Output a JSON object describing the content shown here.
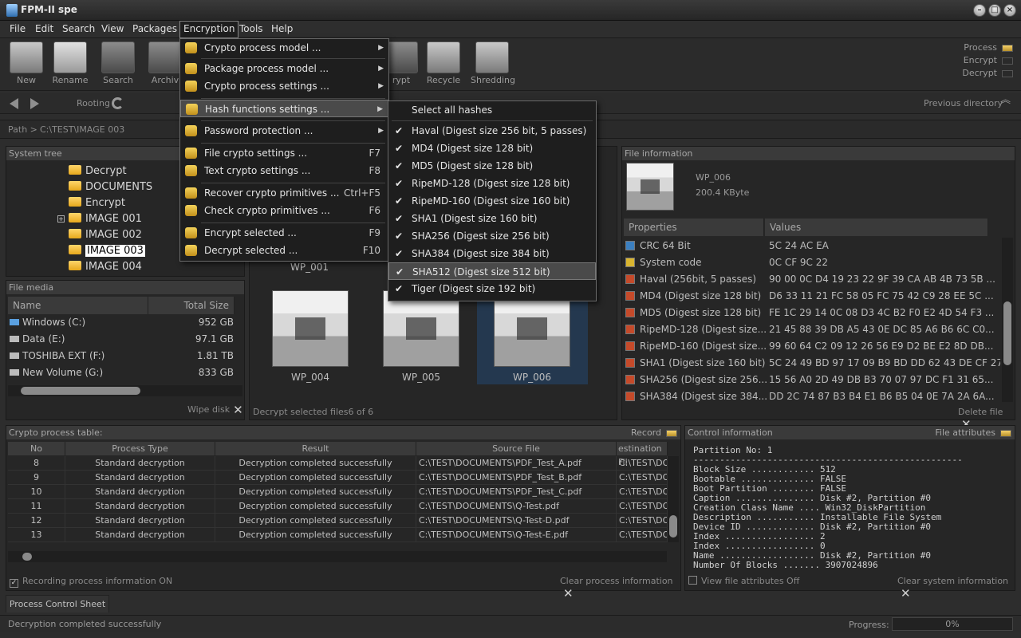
{
  "app": {
    "title": "FPM-II spe"
  },
  "menubar": {
    "items": [
      "File",
      "Edit",
      "Search",
      "View",
      "Packages",
      "Encryption",
      "Tools",
      "Help"
    ]
  },
  "toolbar": {
    "buttons": [
      "New",
      "Rename",
      "Search",
      "Archiv",
      "rypt",
      "Recycle",
      "Shredding"
    ],
    "indicators": [
      "Process",
      "Encrypt",
      "Decrypt"
    ]
  },
  "nav": {
    "rooting": "Rooting",
    "previous": "Previous directory"
  },
  "path": {
    "label": "Path >",
    "value": "C:\\TEST\\IMAGE 003"
  },
  "system_tree": {
    "title": "System tree",
    "items": [
      "Decrypt",
      "DOCUMENTS",
      "Encrypt",
      "IMAGE 001",
      "IMAGE 002",
      "IMAGE 003",
      "IMAGE 004"
    ],
    "expander": "+"
  },
  "file_media": {
    "title": "File media",
    "col_name": "Name",
    "col_size": "Total Size",
    "drives": [
      {
        "name": "Windows  (C:)",
        "size": "952 GB"
      },
      {
        "name": "Data (E:)",
        "size": "97.1 GB"
      },
      {
        "name": "TOSHIBA EXT (F:)",
        "size": "1.81 TB"
      },
      {
        "name": "New Volume (G:)",
        "size": "833 GB"
      }
    ],
    "wipe": "Wipe disk"
  },
  "thumbs": {
    "items": [
      "WP_001",
      "WP_004",
      "WP_005",
      "WP_006"
    ],
    "footer": "Decrypt selected files",
    "count": "6 of 6"
  },
  "file_info": {
    "title": "File information",
    "name": "WP_006",
    "size": "200.4 KByte",
    "col_props": "Properties",
    "col_values": "Values",
    "rows": [
      {
        "p": "CRC 64 Bit",
        "v": "5C 24 AC EA",
        "c": "blue"
      },
      {
        "p": "System code",
        "v": "0C CF 9C 22",
        "c": "yellow"
      },
      {
        "p": "Haval (256bit, 5 passes)",
        "v": "90 00 0C D4 19 23 22 9F 39 CA AB 4B 73 5B ...",
        "c": "red"
      },
      {
        "p": "MD4 (Digest size 128 bit)",
        "v": "D6 33 11 21 FC 58 05 FC 75 42 C9 28 EE 5C ...",
        "c": "red"
      },
      {
        "p": "MD5 (Digest size 128 bit)",
        "v": "FE 1C 29 14 0C 08 D3 4C B2 F0 E2 4D 54 F3 ...",
        "c": "red"
      },
      {
        "p": "RipeMD-128 (Digest size...",
        "v": "21 45 88 39 DB A5 43 0E DC 85 A6 B6 6C C0...",
        "c": "red"
      },
      {
        "p": "RipeMD-160 (Digest size...",
        "v": "99 60 64 C2 09 12 26 56 E9 D2 BE E2 8D DB...",
        "c": "red"
      },
      {
        "p": "SHA1 (Digest size 160 bit)",
        "v": "5C 24 49 BD 97 17 09 B9 BD DD 62 43 DE CF 27...",
        "c": "red"
      },
      {
        "p": "SHA256 (Digest size 256...",
        "v": "15 56 A0 2D 49 DB B3 70 07 97 DC F1 31 65...",
        "c": "red"
      },
      {
        "p": "SHA384 (Digest size 384...",
        "v": "DD 2C 74 87 B3 B4 E1 B6 B5 04 0E 7A 2A 6A...",
        "c": "red"
      }
    ],
    "delete": "Delete file"
  },
  "crypto_table": {
    "title": "Crypto process table:",
    "record": "Record",
    "headers": [
      "No",
      "Process Type",
      "Result",
      "Source File",
      "estination Fil"
    ],
    "rows": [
      {
        "no": "8",
        "type": "Standard decryption",
        "result": "Decryption completed successfully",
        "src": "C:\\TEST\\DOCUMENTS\\PDF_Test_A.pdf",
        "dst": "C:\\TEST\\DO("
      },
      {
        "no": "9",
        "type": "Standard decryption",
        "result": "Decryption completed successfully",
        "src": "C:\\TEST\\DOCUMENTS\\PDF_Test_B.pdf",
        "dst": "C:\\TEST\\DO("
      },
      {
        "no": "10",
        "type": "Standard decryption",
        "result": "Decryption completed successfully",
        "src": "C:\\TEST\\DOCUMENTS\\PDF_Test_C.pdf",
        "dst": "C:\\TEST\\DO("
      },
      {
        "no": "11",
        "type": "Standard decryption",
        "result": "Decryption completed successfully",
        "src": "C:\\TEST\\DOCUMENTS\\Q-Test.pdf",
        "dst": "C:\\TEST\\DO("
      },
      {
        "no": "12",
        "type": "Standard decryption",
        "result": "Decryption completed successfully",
        "src": "C:\\TEST\\DOCUMENTS\\Q-Test-D.pdf",
        "dst": "C:\\TEST\\DO("
      },
      {
        "no": "13",
        "type": "Standard decryption",
        "result": "Decryption completed successfully",
        "src": "C:\\TEST\\DOCUMENTS\\Q-Test-E.pdf",
        "dst": "C:\\TEST\\DO("
      }
    ],
    "recording": "Recording process information ON",
    "clear": "Clear process information"
  },
  "control": {
    "title": "Control information",
    "attrs": "File attributes",
    "text": "Partition No: 1\n---------------------------------------------------\nBlock Size ............ 512\nBootable .............. FALSE\nBoot Partition ........ FALSE\nCaption ............... Disk #2, Partition #0\nCreation Class Name .... Win32_DiskPartition\nDescription ........... Installable File System\nDevice ID ............. Disk #2, Partition #0\nIndex ................. 2\nIndex ................. 0\nName .................. Disk #2, Partition #0\nNumber Of Blocks ....... 3907024896",
    "view": "View file attributes Off",
    "clear": "Clear system information"
  },
  "tabs": {
    "sheet": "Process Control Sheet"
  },
  "status": {
    "text": "Decryption completed successfully",
    "progress_label": "Progress:",
    "progress": "0%"
  },
  "encryption_menu": {
    "items": [
      {
        "label": "Crypto process model ...",
        "sc": "",
        "sub": true
      },
      {
        "label": "Package process model ...",
        "sc": "",
        "sub": true
      },
      {
        "label": "Crypto process settings ...",
        "sc": "",
        "sub": true
      },
      {
        "label": "Hash functions settings ...",
        "sc": "",
        "sub": true
      },
      {
        "label": "Password protection ...",
        "sc": "",
        "sub": true
      },
      {
        "label": "File crypto settings ...",
        "sc": "F7",
        "sub": false
      },
      {
        "label": "Text crypto settings ...",
        "sc": "F8",
        "sub": false
      },
      {
        "label": "Recover crypto primitives ...",
        "sc": "Ctrl+F5",
        "sub": false
      },
      {
        "label": "Check crypto primitives ...",
        "sc": "F6",
        "sub": false
      },
      {
        "label": "Encrypt selected ...",
        "sc": "F9",
        "sub": false
      },
      {
        "label": "Decrypt selected ...",
        "sc": "F10",
        "sub": false
      }
    ]
  },
  "hash_menu": {
    "items": [
      "Select all hashes",
      "Haval (Digest size 256 bit, 5 passes)",
      "MD4 (Digest size 128 bit)",
      "MD5 (Digest size 128 bit)",
      "RipeMD-128 (Digest size 128 bit)",
      "RipeMD-160 (Digest size 160 bit)",
      "SHA1 (Digest size 160 bit)",
      "SHA256 (Digest size 256 bit)",
      "SHA384 (Digest size 384 bit)",
      "SHA512 (Digest size 512 bit)",
      "Tiger (Digest size 192 bit)"
    ],
    "check": "✔"
  }
}
